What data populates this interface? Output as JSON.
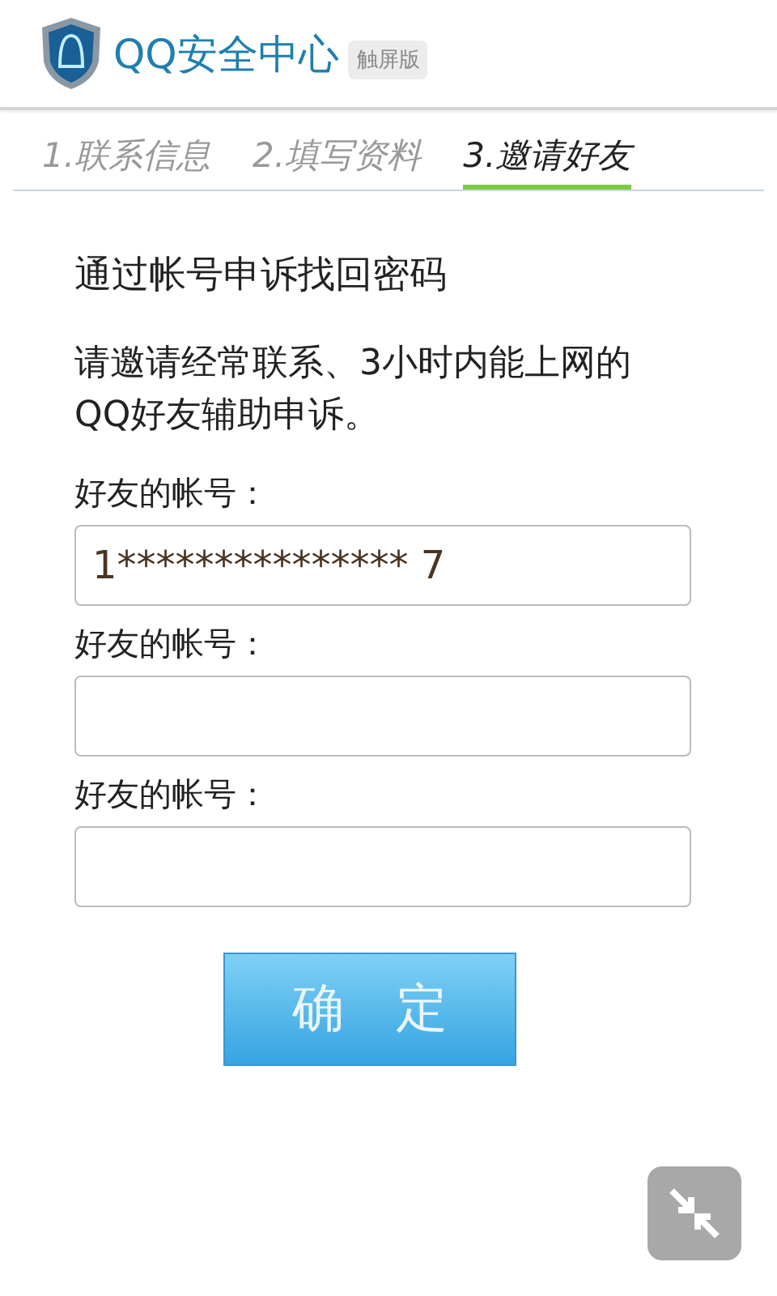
{
  "header": {
    "title": "QQ安全中心",
    "badge": "触屏版"
  },
  "tabs": [
    {
      "label": "1.联系信息",
      "selected": false
    },
    {
      "label": "2.填写资料",
      "selected": false
    },
    {
      "label": "3.邀请好友",
      "selected": true
    }
  ],
  "heading": "通过帐号申诉找回密码",
  "description": "请邀请经常联系、3小时内能上网的QQ好友辅助申诉。",
  "fields": [
    {
      "label": "好友的帐号：",
      "value": "1*************** 7"
    },
    {
      "label": "好友的帐号："
    },
    {
      "label": "好友的帐号："
    }
  ],
  "submit": "确　定"
}
